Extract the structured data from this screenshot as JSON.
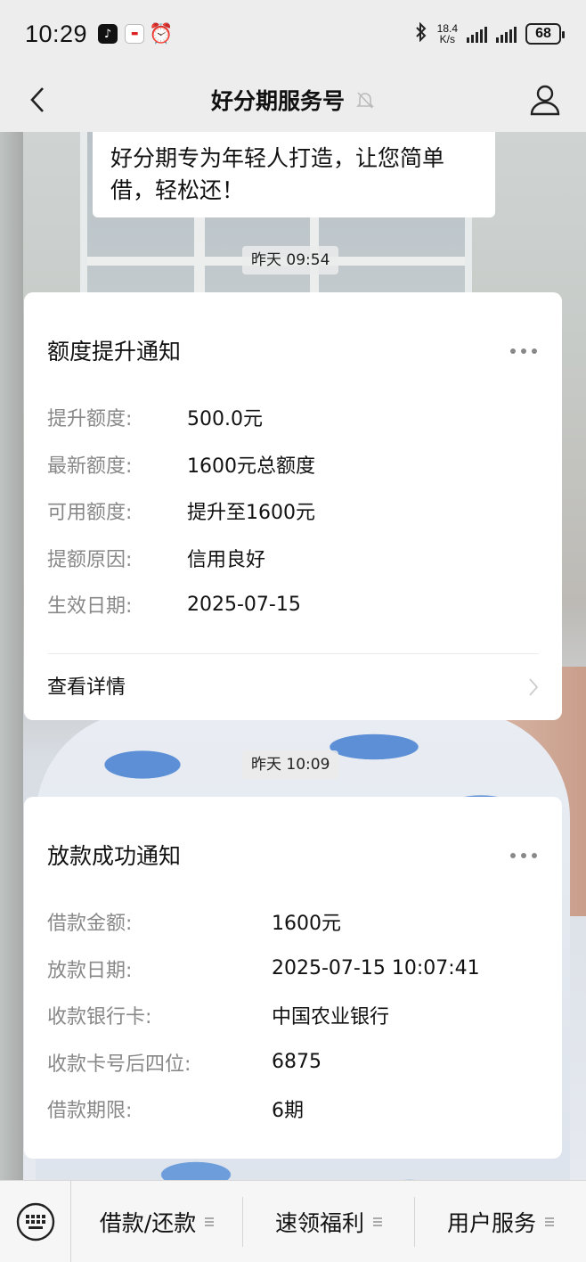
{
  "status_bar": {
    "time": "10:29",
    "net_speed_top": "18.4",
    "net_speed_bottom": "K/s",
    "battery": "68"
  },
  "nav": {
    "title": "好分期服务号"
  },
  "intro_message": "好分期专为年轻人打造，让您简单借，轻松还！",
  "timestamps": [
    "昨天 09:54",
    "昨天 10:09"
  ],
  "card_limit": {
    "title": "额度提升通知",
    "rows": [
      {
        "label": "提升额度:",
        "value": "500.0元"
      },
      {
        "label": "最新额度:",
        "value": "1600元总额度"
      },
      {
        "label": "可用额度:",
        "value": "提升至1600元"
      },
      {
        "label": "提额原因:",
        "value": "信用良好"
      },
      {
        "label": "生效日期:",
        "value": "2025-07-15"
      }
    ],
    "detail_link": "查看详情"
  },
  "card_loan": {
    "title": "放款成功通知",
    "rows": [
      {
        "label": "借款金额:",
        "value": "1600元"
      },
      {
        "label": "放款日期:",
        "value": "2025-07-15 10:07:41"
      },
      {
        "label": "收款银行卡:",
        "value": "中国农业银行"
      },
      {
        "label": "收款卡号后四位:",
        "value": "6875"
      },
      {
        "label": "借款期限:",
        "value": "6期"
      }
    ]
  },
  "bottom_menu": [
    "借款/还款",
    "速领福利",
    "用户服务"
  ]
}
